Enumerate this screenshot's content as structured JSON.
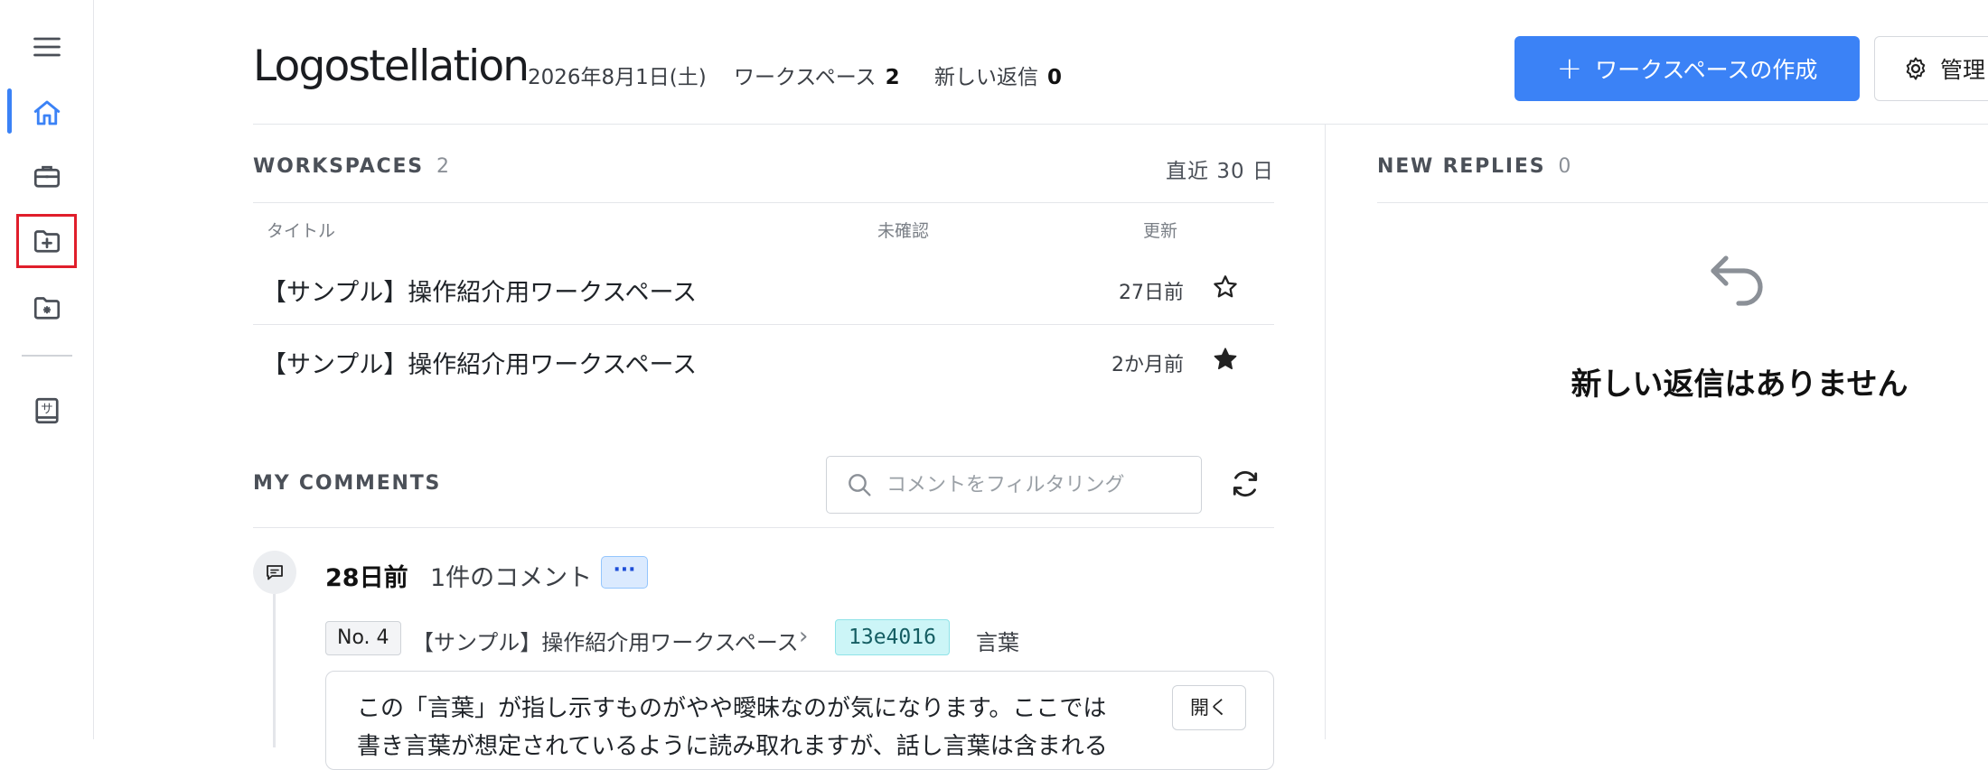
{
  "app": {
    "logo": "Logostellation"
  },
  "sidebar": {
    "items": [
      {
        "name": "menu",
        "icon": "hamburger-menu-icon"
      },
      {
        "name": "home",
        "icon": "home-icon",
        "active": true
      },
      {
        "name": "briefcase",
        "icon": "briefcase-icon"
      },
      {
        "name": "add-folder",
        "icon": "folder-plus-icon",
        "highlighted": true
      },
      {
        "name": "folder-settings",
        "icon": "folder-gear-icon"
      },
      {
        "name": "sample-book",
        "icon": "book-icon",
        "glyph": "サ"
      }
    ],
    "accent": "#3b82f6",
    "highlight_color": "#e01e2b"
  },
  "header": {
    "date": "2026年8月1日(土)",
    "workspaces_label": "ワークスペース",
    "workspaces_count": "2",
    "new_replies_label": "新しい返信",
    "new_replies_count": "0",
    "create_button": "ワークスペースの作成",
    "manage_button": "管理"
  },
  "workspaces": {
    "title": "WORKSPACES",
    "count": "2",
    "range": "直近 30 日",
    "columns": {
      "title": "タイトル",
      "unread": "未確認",
      "updated": "更新"
    },
    "rows": [
      {
        "title": "【サンプル】操作紹介用ワークスペース",
        "unread": "",
        "updated": "27日前",
        "starred": false
      },
      {
        "title": "【サンプル】操作紹介用ワークスペース",
        "unread": "",
        "updated": "2か月前",
        "starred": true
      }
    ]
  },
  "comments": {
    "title": "MY COMMENTS",
    "search_placeholder": "コメントをフィルタリング",
    "items": [
      {
        "time": "28日前",
        "count": "1件のコメント",
        "more": "···",
        "number": "No. 4",
        "workspace": "【サンプル】操作紹介用ワークスペース",
        "separator": "›",
        "hash": "13e4016",
        "target": "言葉",
        "text": "この「言葉」が指し示すものがやや曖昧なのが気になります。ここでは書き言葉が想定されているように読み取れますが、話し言葉は含まれる",
        "open_button": "開く"
      }
    ]
  },
  "replies": {
    "title": "NEW REPLIES",
    "count": "0",
    "empty_message": "新しい返信はありません"
  }
}
